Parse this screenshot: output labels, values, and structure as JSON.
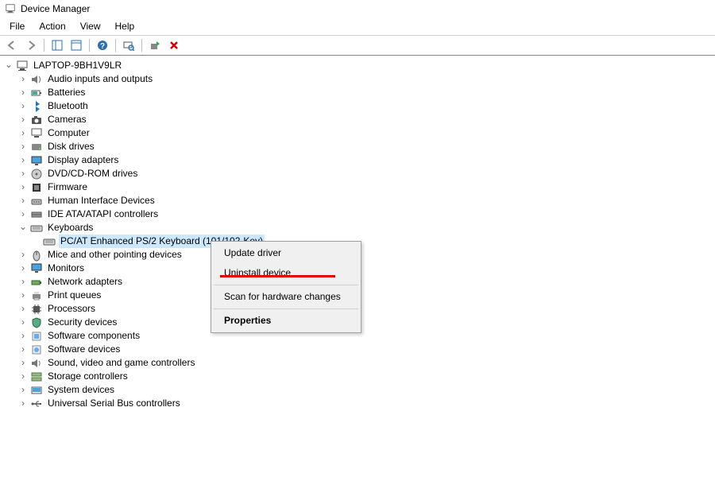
{
  "window": {
    "title": "Device Manager"
  },
  "menu": {
    "file": "File",
    "action": "Action",
    "view": "View",
    "help": "Help"
  },
  "tree": {
    "root": "LAPTOP-9BH1V9LR",
    "items": [
      "Audio inputs and outputs",
      "Batteries",
      "Bluetooth",
      "Cameras",
      "Computer",
      "Disk drives",
      "Display adapters",
      "DVD/CD-ROM drives",
      "Firmware",
      "Human Interface Devices",
      "IDE ATA/ATAPI controllers",
      "Keyboards",
      "Mice and other pointing devices",
      "Monitors",
      "Network adapters",
      "Print queues",
      "Processors",
      "Security devices",
      "Software components",
      "Software devices",
      "Sound, video and game controllers",
      "Storage controllers",
      "System devices",
      "Universal Serial Bus controllers"
    ],
    "keyboard_child": "PC/AT Enhanced PS/2 Keyboard (101/102-Key)"
  },
  "context_menu": {
    "update": "Update driver",
    "uninstall": "Uninstall device",
    "scan": "Scan for hardware changes",
    "properties": "Properties"
  }
}
